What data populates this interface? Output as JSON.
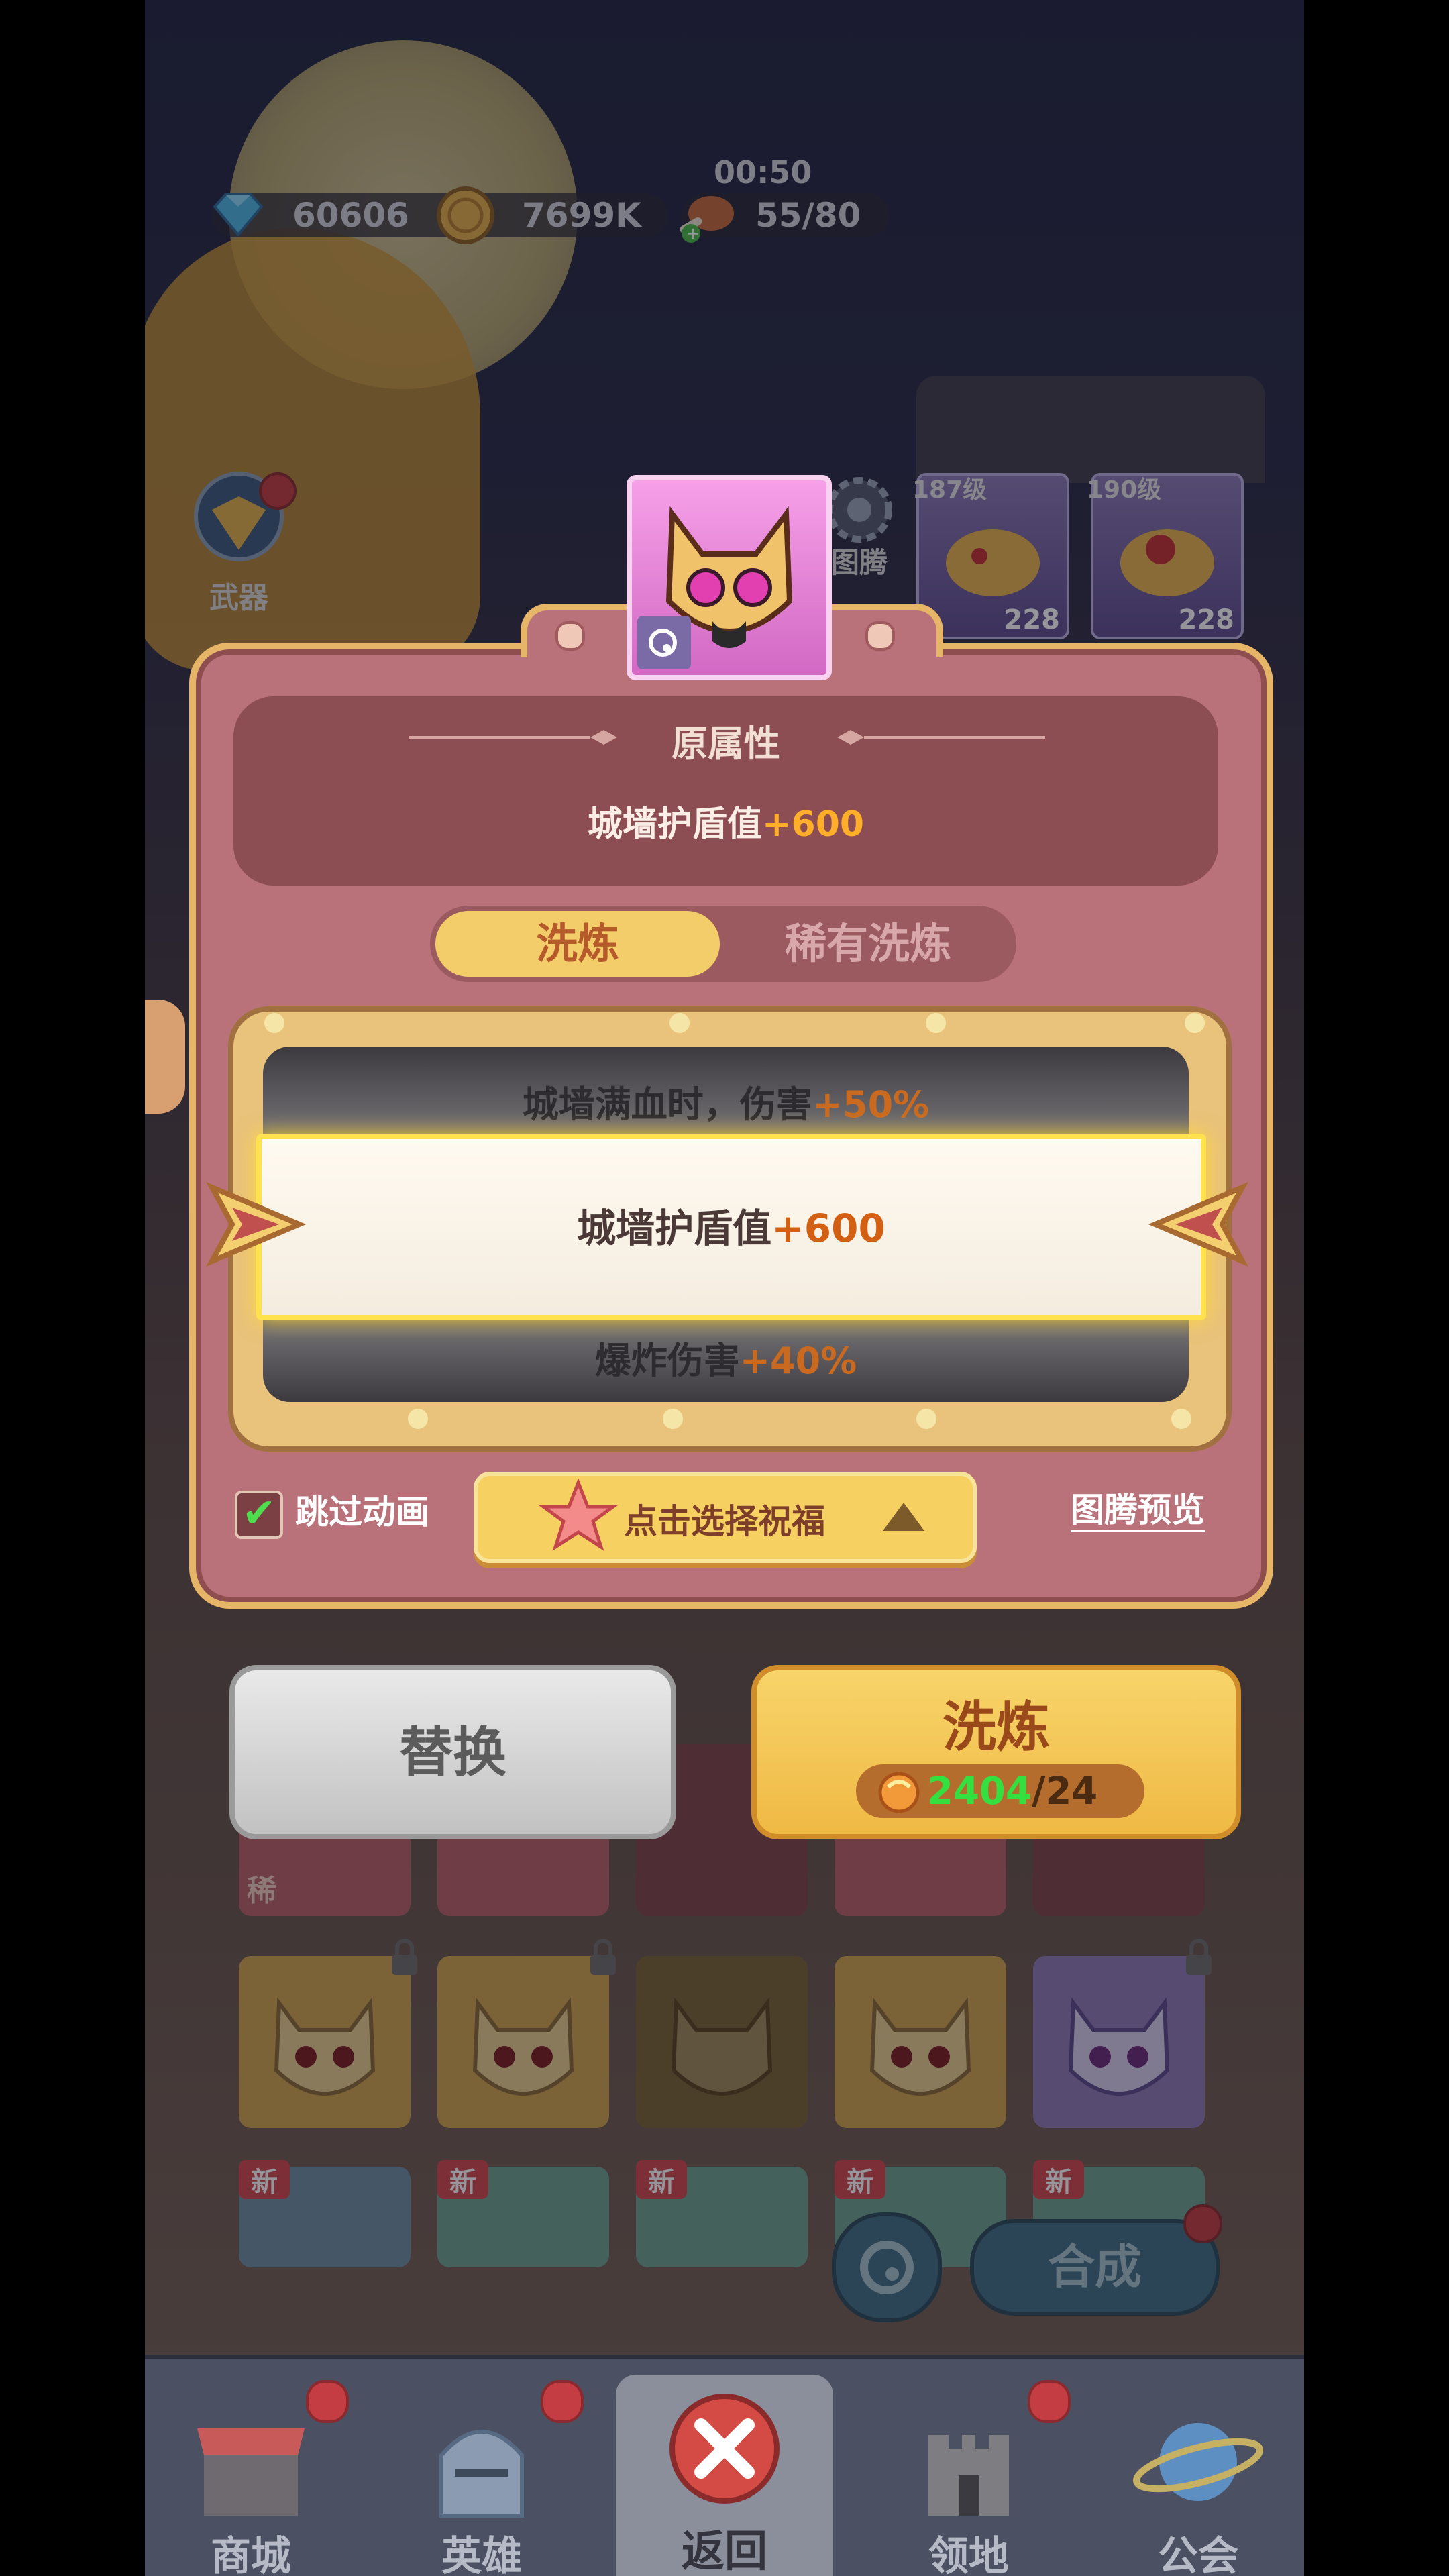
{
  "resources": {
    "diamonds": "60606",
    "coins": "7699K",
    "timer": "00:50",
    "stamina": "55/80"
  },
  "background": {
    "weapon_label": "武器",
    "totem_label": "图腾",
    "hero_cards": [
      {
        "level": "187级",
        "power": "228"
      },
      {
        "level": "190级",
        "power": "228"
      }
    ],
    "rare_tag": "稀",
    "new_tag": "新",
    "compose_label": "合成"
  },
  "popup": {
    "original_title": "原属性",
    "original_attr": {
      "text": "城墙护盾值",
      "value": "+600"
    },
    "tabs": [
      {
        "label": "洗炼",
        "active": true
      },
      {
        "label": "稀有洗炼",
        "active": false
      }
    ],
    "slot": {
      "prev": {
        "text": "城墙满血时，伤害",
        "value": "+50%"
      },
      "selected": {
        "text": "城墙护盾值",
        "value": "+600"
      },
      "next": {
        "text": "爆炸伤害",
        "value": "+40%"
      }
    },
    "skip_animation": {
      "label": "跳过动画",
      "checked": true
    },
    "bless_button": "点击选择祝福",
    "preview_link": "图腾预览"
  },
  "actions": {
    "replace_label": "替换",
    "wash_label": "洗炼",
    "cost_have": "2404",
    "cost_need": "/24"
  },
  "nav": {
    "items": [
      {
        "label": "商城",
        "icon": "shop-icon"
      },
      {
        "label": "英雄",
        "icon": "knight-helmet-icon"
      },
      {
        "label": "返回",
        "icon": "close-icon"
      },
      {
        "label": "领地",
        "icon": "castle-icon"
      },
      {
        "label": "公会",
        "icon": "planet-icon"
      }
    ]
  },
  "colors": {
    "accent_gold": "#ffae2a",
    "value_orange": "#d35f12",
    "panel": "#b9727a",
    "tab_active": "#f3cd6a"
  }
}
